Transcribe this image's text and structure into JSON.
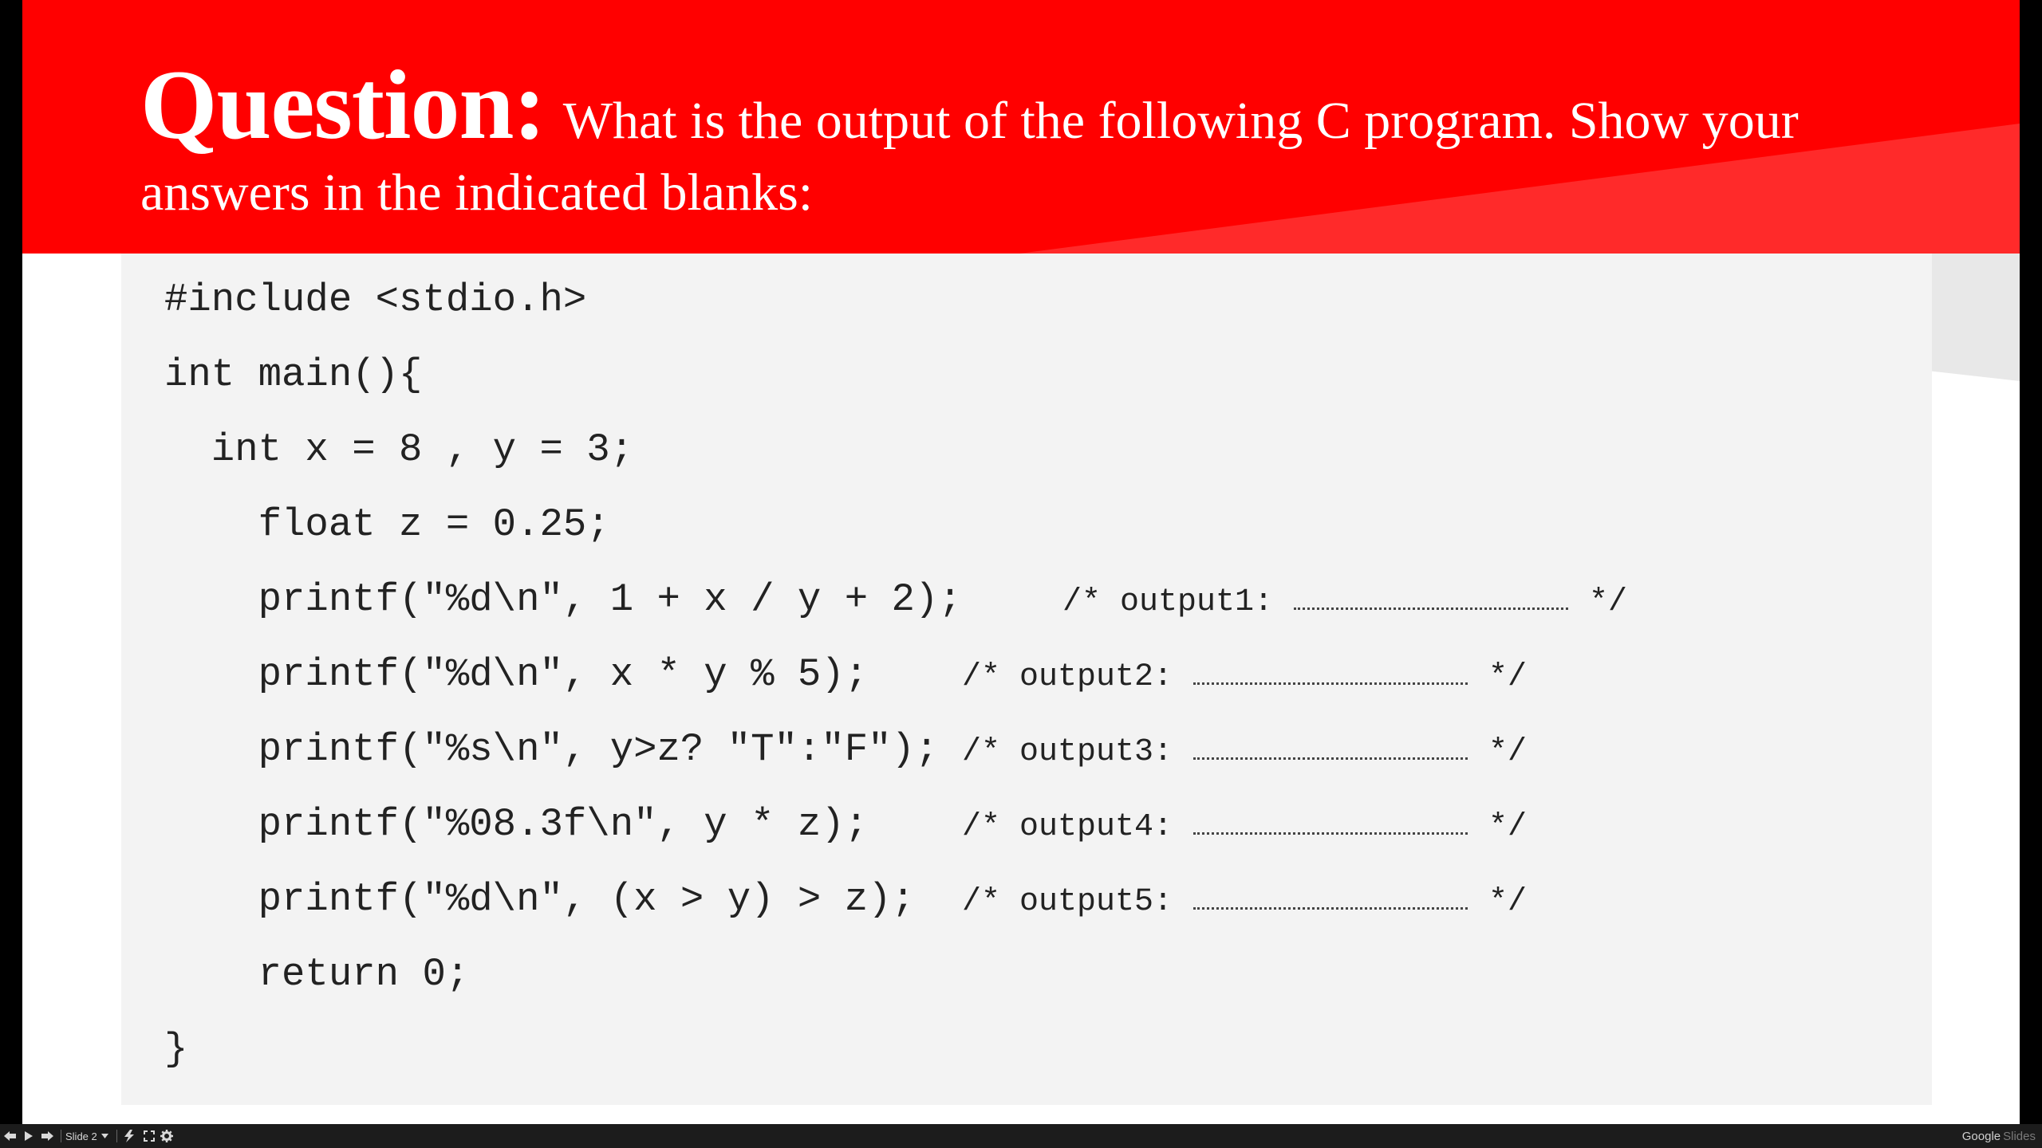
{
  "slide": {
    "title_word": "Question:",
    "title_rest": "What is the output of the following C program. Show your",
    "title_line2": "answers in the indicated blanks:",
    "colors": {
      "banner": "#ff0000",
      "code_background": "#f3f3f3",
      "text_on_banner": "#ffffff"
    }
  },
  "code": {
    "lines": [
      "#include <stdio.h>",
      "int main(){",
      "  int x = 8 , y = 3;",
      "    float z = 0.25;",
      "    printf(\"%d\\n\", 1 + x / y + 2);",
      "    printf(\"%d\\n\", x * y % 5);",
      "    printf(\"%s\\n\", y>z? \"T\":\"F\");",
      "    printf(\"%08.3f\\n\", y * z);",
      "    printf(\"%d\\n\", (x > y) > z);",
      "    return 0;",
      "}"
    ],
    "comments": [
      {
        "open": "/*",
        "label": "output1:",
        "close": "*/"
      },
      {
        "open": "/*",
        "label": "output2:",
        "close": "*/"
      },
      {
        "open": "/*",
        "label": "output3:",
        "close": "*/"
      },
      {
        "open": "/*",
        "label": "output4:",
        "close": "*/"
      },
      {
        "open": "/*",
        "label": "output5:",
        "close": "*/"
      }
    ]
  },
  "taskbar": {
    "slide_label": "Slide 2",
    "icons": [
      "previous-icon",
      "play-icon",
      "next-icon",
      "chevron-down-icon",
      "laser-pointer-icon",
      "fullscreen-icon",
      "gear-icon"
    ],
    "brand_google": "Google",
    "brand_slides": "Slides"
  }
}
